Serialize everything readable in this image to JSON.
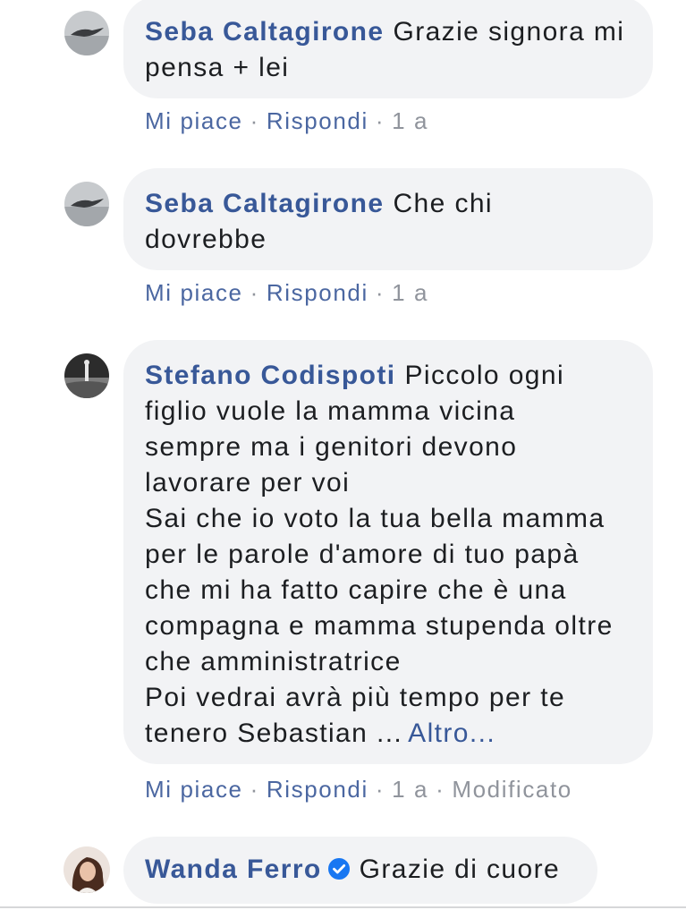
{
  "separator": "·",
  "colors": {
    "bubble": "#f2f3f5",
    "name": "#385898",
    "text": "#1c1e21",
    "meta_link": "#4b67a1",
    "meta_muted": "#90949c",
    "verified": "#1877f2"
  },
  "comments": [
    {
      "author": "Seba Caltagirone",
      "first_line": "Grazie signora mi",
      "lines": [
        "pensa + lei"
      ],
      "actions": {
        "like": "Mi piace",
        "reply": "Rispondi",
        "time": "1 a"
      }
    },
    {
      "author": "Seba Caltagirone",
      "first_line": "Che chi",
      "lines": [
        "dovrebbe"
      ],
      "actions": {
        "like": "Mi piace",
        "reply": "Rispondi",
        "time": "1 a"
      }
    },
    {
      "author": "Stefano Codispoti",
      "first_line": "Piccolo ogni",
      "lines": [
        "figlio vuole la mamma vicina",
        "sempre ma i genitori devono",
        "lavorare per voi",
        "Sai che io voto la tua bella mamma",
        "per le parole d'amore di tuo papà",
        "che mi ha fatto capire che è una",
        "compagna e mamma stupenda oltre",
        "che amministratrice",
        "Poi vedrai avrà più tempo per te",
        "tenero Sebastian ..."
      ],
      "more_link": "Altro...",
      "actions": {
        "like": "Mi piace",
        "reply": "Rispondi",
        "time": "1 a",
        "edited": "Modificato"
      }
    },
    {
      "author": "Wanda Ferro",
      "verified": true,
      "verified_icon": "verified-badge-icon",
      "first_line": "Grazie di cuore",
      "lines": []
    }
  ]
}
